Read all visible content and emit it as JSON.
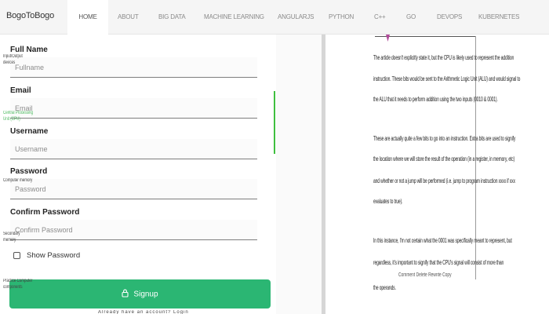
{
  "nav": {
    "brand": "BogoToBogo",
    "items": [
      "HOME",
      "ABOUT",
      "BIG DATA",
      "MACHINE LEARNING",
      "ANGULARJS",
      "PYTHON",
      "C++",
      "GO",
      "DEVOPS",
      "KUBERNETES"
    ],
    "active_index": 0
  },
  "form": {
    "fields": [
      {
        "label": "Full Name",
        "placeholder": "Fullname"
      },
      {
        "label": "Email",
        "placeholder": "Email"
      },
      {
        "label": "Username",
        "placeholder": "Username"
      },
      {
        "label": "Password",
        "placeholder": "Password"
      },
      {
        "label": "Confirm Password",
        "placeholder": "Confirm Password"
      }
    ],
    "show_password_label": "Show Password",
    "show_password_checked": false,
    "signup_label": "Signup",
    "signup_color": "#2bb673"
  },
  "diagram": {
    "items": [
      {
        "label": "Input/Output devices",
        "active": false
      },
      {
        "label": "Central Processing Unit (CPU)",
        "active": true
      },
      {
        "label": "Computer memory",
        "active": false
      },
      {
        "label": "Secondary memory",
        "active": false
      },
      {
        "label": "Practice Computer components",
        "active": false
      }
    ],
    "active_color": "#3fbf3f"
  },
  "document": {
    "paragraph_1": [
      "The article doesn't explicitly state it, but the CPU is likely used to represent the addition",
      "instruction. These bits would be sent to the Arithmetic Logic Unit (ALU) and would signal to",
      "the ALU that it needs to perform addition using the two inputs (0010 & 0001)."
    ],
    "paragraph_2": [
      "These are actually quite a few bits to go into an instruction. Extra bits are used to signify",
      "the location where we will store the result of the operation (in a register, in memory, etc)",
      "and whether or not a jump will be performed (i.e. jump to program instruction xxxx if xxx",
      "evaluates to true)."
    ],
    "paragraph_3": [
      "In this instance, I'm not certain what the 0001 was specifically meant to represent, but",
      "regardless, it's important to signify that the CPU's signal will consist of more than",
      "the operands."
    ],
    "overlay_text": "Comment     Delete     Rewrite     Copy"
  }
}
